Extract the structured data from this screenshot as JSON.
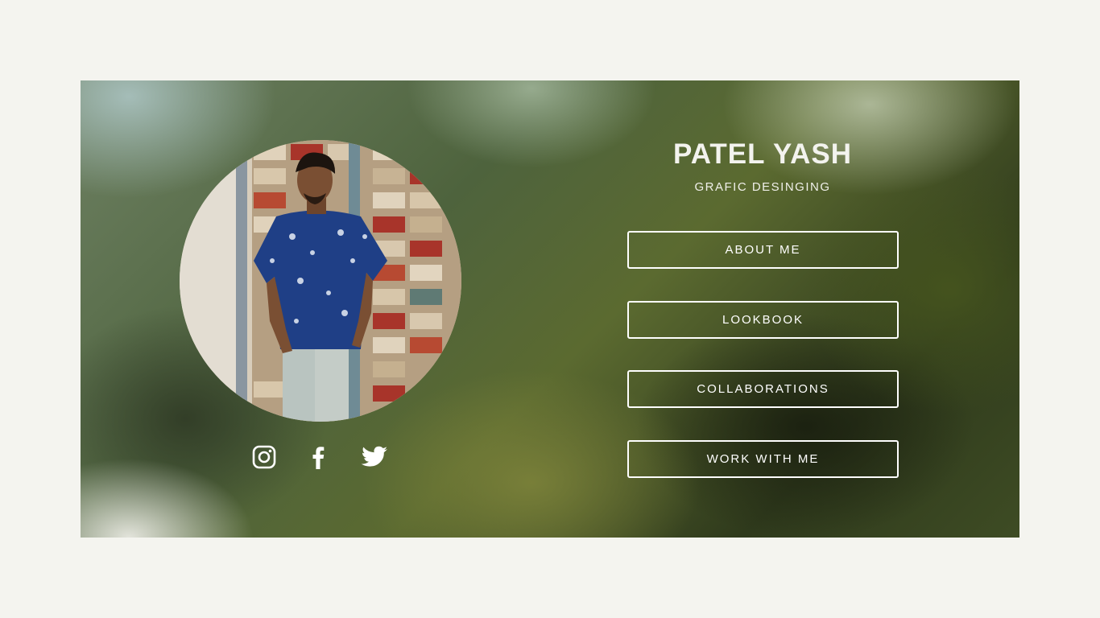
{
  "profile": {
    "name": "PATEL YASH",
    "subtitle": "GRAFIC DESINGING"
  },
  "nav": {
    "about": "ABOUT ME",
    "lookbook": "LOOKBOOK",
    "collaborations": "COLLABORATIONS",
    "work": "WORK WITH ME"
  },
  "social": {
    "icons": [
      "instagram-icon",
      "facebook-icon",
      "twitter-icon"
    ]
  },
  "colors": {
    "page_background": "#f4f4ef",
    "text": "#ffffff",
    "shirt": "#1f3f86",
    "brick_red": "#a8342a"
  }
}
